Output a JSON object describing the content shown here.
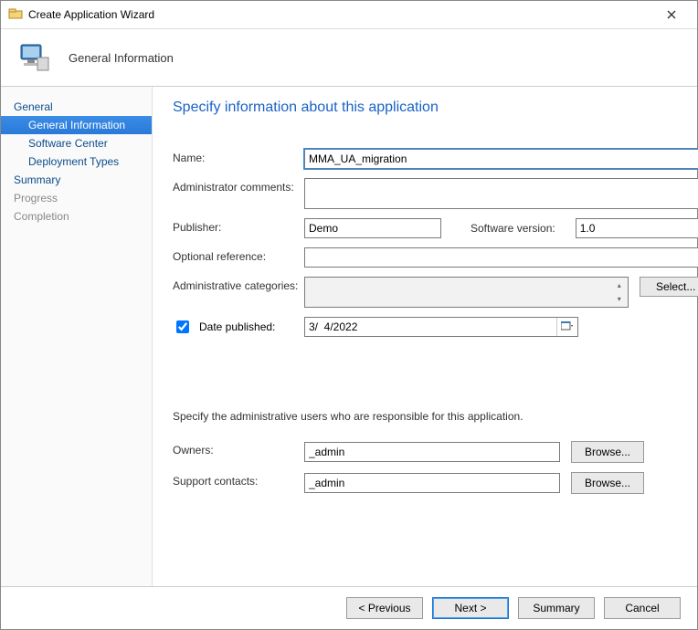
{
  "window": {
    "title": "Create Application Wizard"
  },
  "banner": {
    "title": "General Information"
  },
  "nav": {
    "items": [
      {
        "label": "General",
        "level": 0,
        "selected": false,
        "muted": false
      },
      {
        "label": "General Information",
        "level": 1,
        "selected": true,
        "muted": false
      },
      {
        "label": "Software Center",
        "level": 1,
        "selected": false,
        "muted": false
      },
      {
        "label": "Deployment Types",
        "level": 1,
        "selected": false,
        "muted": false
      },
      {
        "label": "Summary",
        "level": 0,
        "selected": false,
        "muted": false
      },
      {
        "label": "Progress",
        "level": 0,
        "selected": false,
        "muted": true
      },
      {
        "label": "Completion",
        "level": 0,
        "selected": false,
        "muted": true
      }
    ]
  },
  "content": {
    "heading": "Specify information about this application",
    "labels": {
      "name": "Name:",
      "admin_comments": "Administrator comments:",
      "publisher": "Publisher:",
      "software_version": "Software version:",
      "optional_reference": "Optional reference:",
      "admin_categories": "Administrative categories:",
      "date_published": "Date published:",
      "section_text": "Specify the administrative users who are responsible for this application.",
      "owners": "Owners:",
      "support_contacts": "Support contacts:"
    },
    "values": {
      "name": "MMA_UA_migration",
      "admin_comments": "",
      "publisher": "Demo",
      "software_version": "1.0",
      "optional_reference": "",
      "admin_categories": "",
      "date_published_checked": true,
      "date_published": "3/  4/2022",
      "owners": "_admin",
      "support_contacts": "_admin"
    },
    "buttons": {
      "select": "Select...",
      "browse": "Browse..."
    }
  },
  "footer": {
    "previous": "< Previous",
    "next": "Next >",
    "summary": "Summary",
    "cancel": "Cancel"
  }
}
